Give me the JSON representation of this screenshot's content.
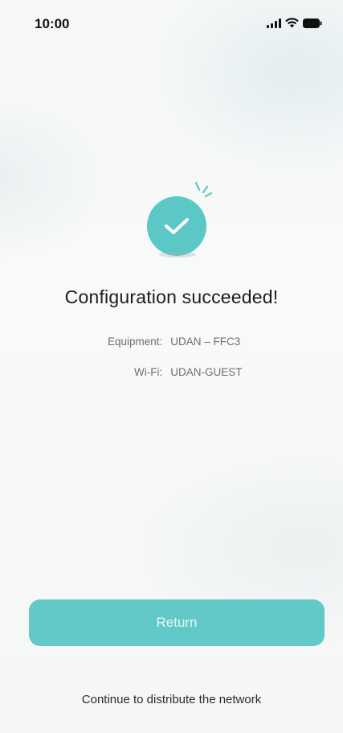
{
  "status_bar": {
    "time": "10:00",
    "icons": [
      "signal-icon",
      "wifi-icon",
      "battery-icon"
    ]
  },
  "success": {
    "icon": "check-circle-icon",
    "title": "Configuration succeeded!"
  },
  "details": {
    "equipment_label": "Equipment:",
    "equipment_value": "UDAN – FFC3",
    "wifi_label": "Wi-Fi:",
    "wifi_value": "UDAN-GUEST"
  },
  "actions": {
    "return_label": "Return",
    "continue_label": "Continue to distribute the network"
  },
  "colors": {
    "accent": "#62c9c8",
    "accent_icon": "#5cc7c7",
    "background": "#f6f8f8",
    "text_primary": "#1c1c1c",
    "text_secondary": "#6e6e6e"
  }
}
